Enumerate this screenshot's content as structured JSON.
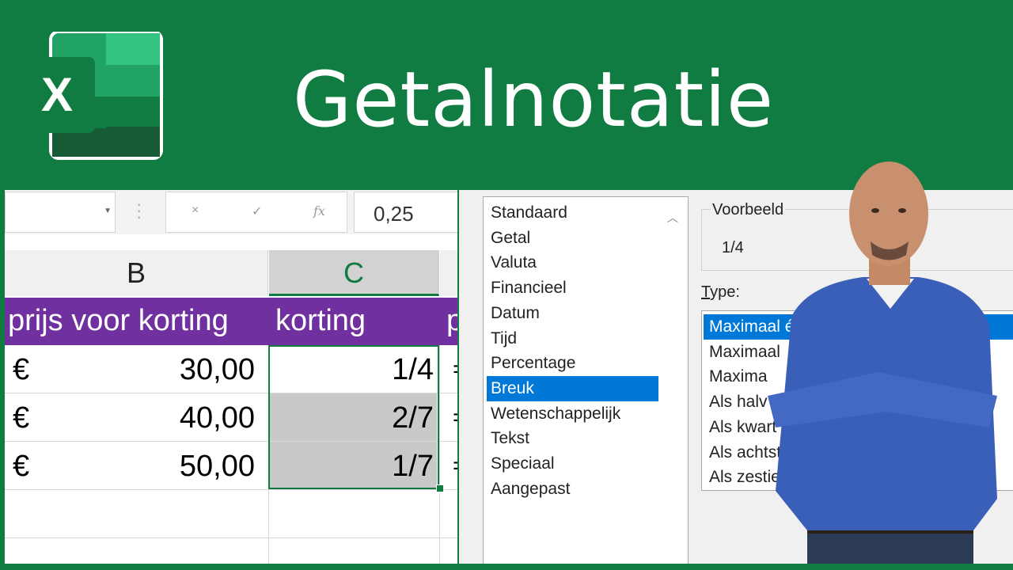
{
  "banner": {
    "title": "Getalnotatie",
    "logo_letter": "X"
  },
  "formula_bar": {
    "cancel": "×",
    "enter": "✓",
    "fx": "fx",
    "value": "0,25"
  },
  "columns": {
    "b": "B",
    "c": "C"
  },
  "header_row": {
    "prijs": "prijs voor korting",
    "korting": "korting",
    "next": "p"
  },
  "rows": [
    {
      "currency": "€",
      "amount": "30,00",
      "fraction": "1/4",
      "eq": "="
    },
    {
      "currency": "€",
      "amount": "40,00",
      "fraction": "2/7",
      "eq": "="
    },
    {
      "currency": "€",
      "amount": "50,00",
      "fraction": "1/7",
      "eq": "="
    }
  ],
  "categories": [
    "Standaard",
    "Getal",
    "Valuta",
    "Financieel",
    "Datum",
    "Tijd",
    "Percentage",
    "Breuk",
    "Wetenschappelijk",
    "Tekst",
    "Speciaal",
    "Aangepast"
  ],
  "preview": {
    "label": "Voorbeeld",
    "value": "1/4"
  },
  "type": {
    "label": "Type:"
  },
  "types": [
    "Maximaal é",
    "Maximaal",
    "Maxima",
    "Als halv",
    "Als kwart",
    "Als achtste",
    "Als zestiende"
  ],
  "colors": {
    "brand": "#107c41",
    "header": "#7030a0",
    "select": "#0078d7"
  }
}
